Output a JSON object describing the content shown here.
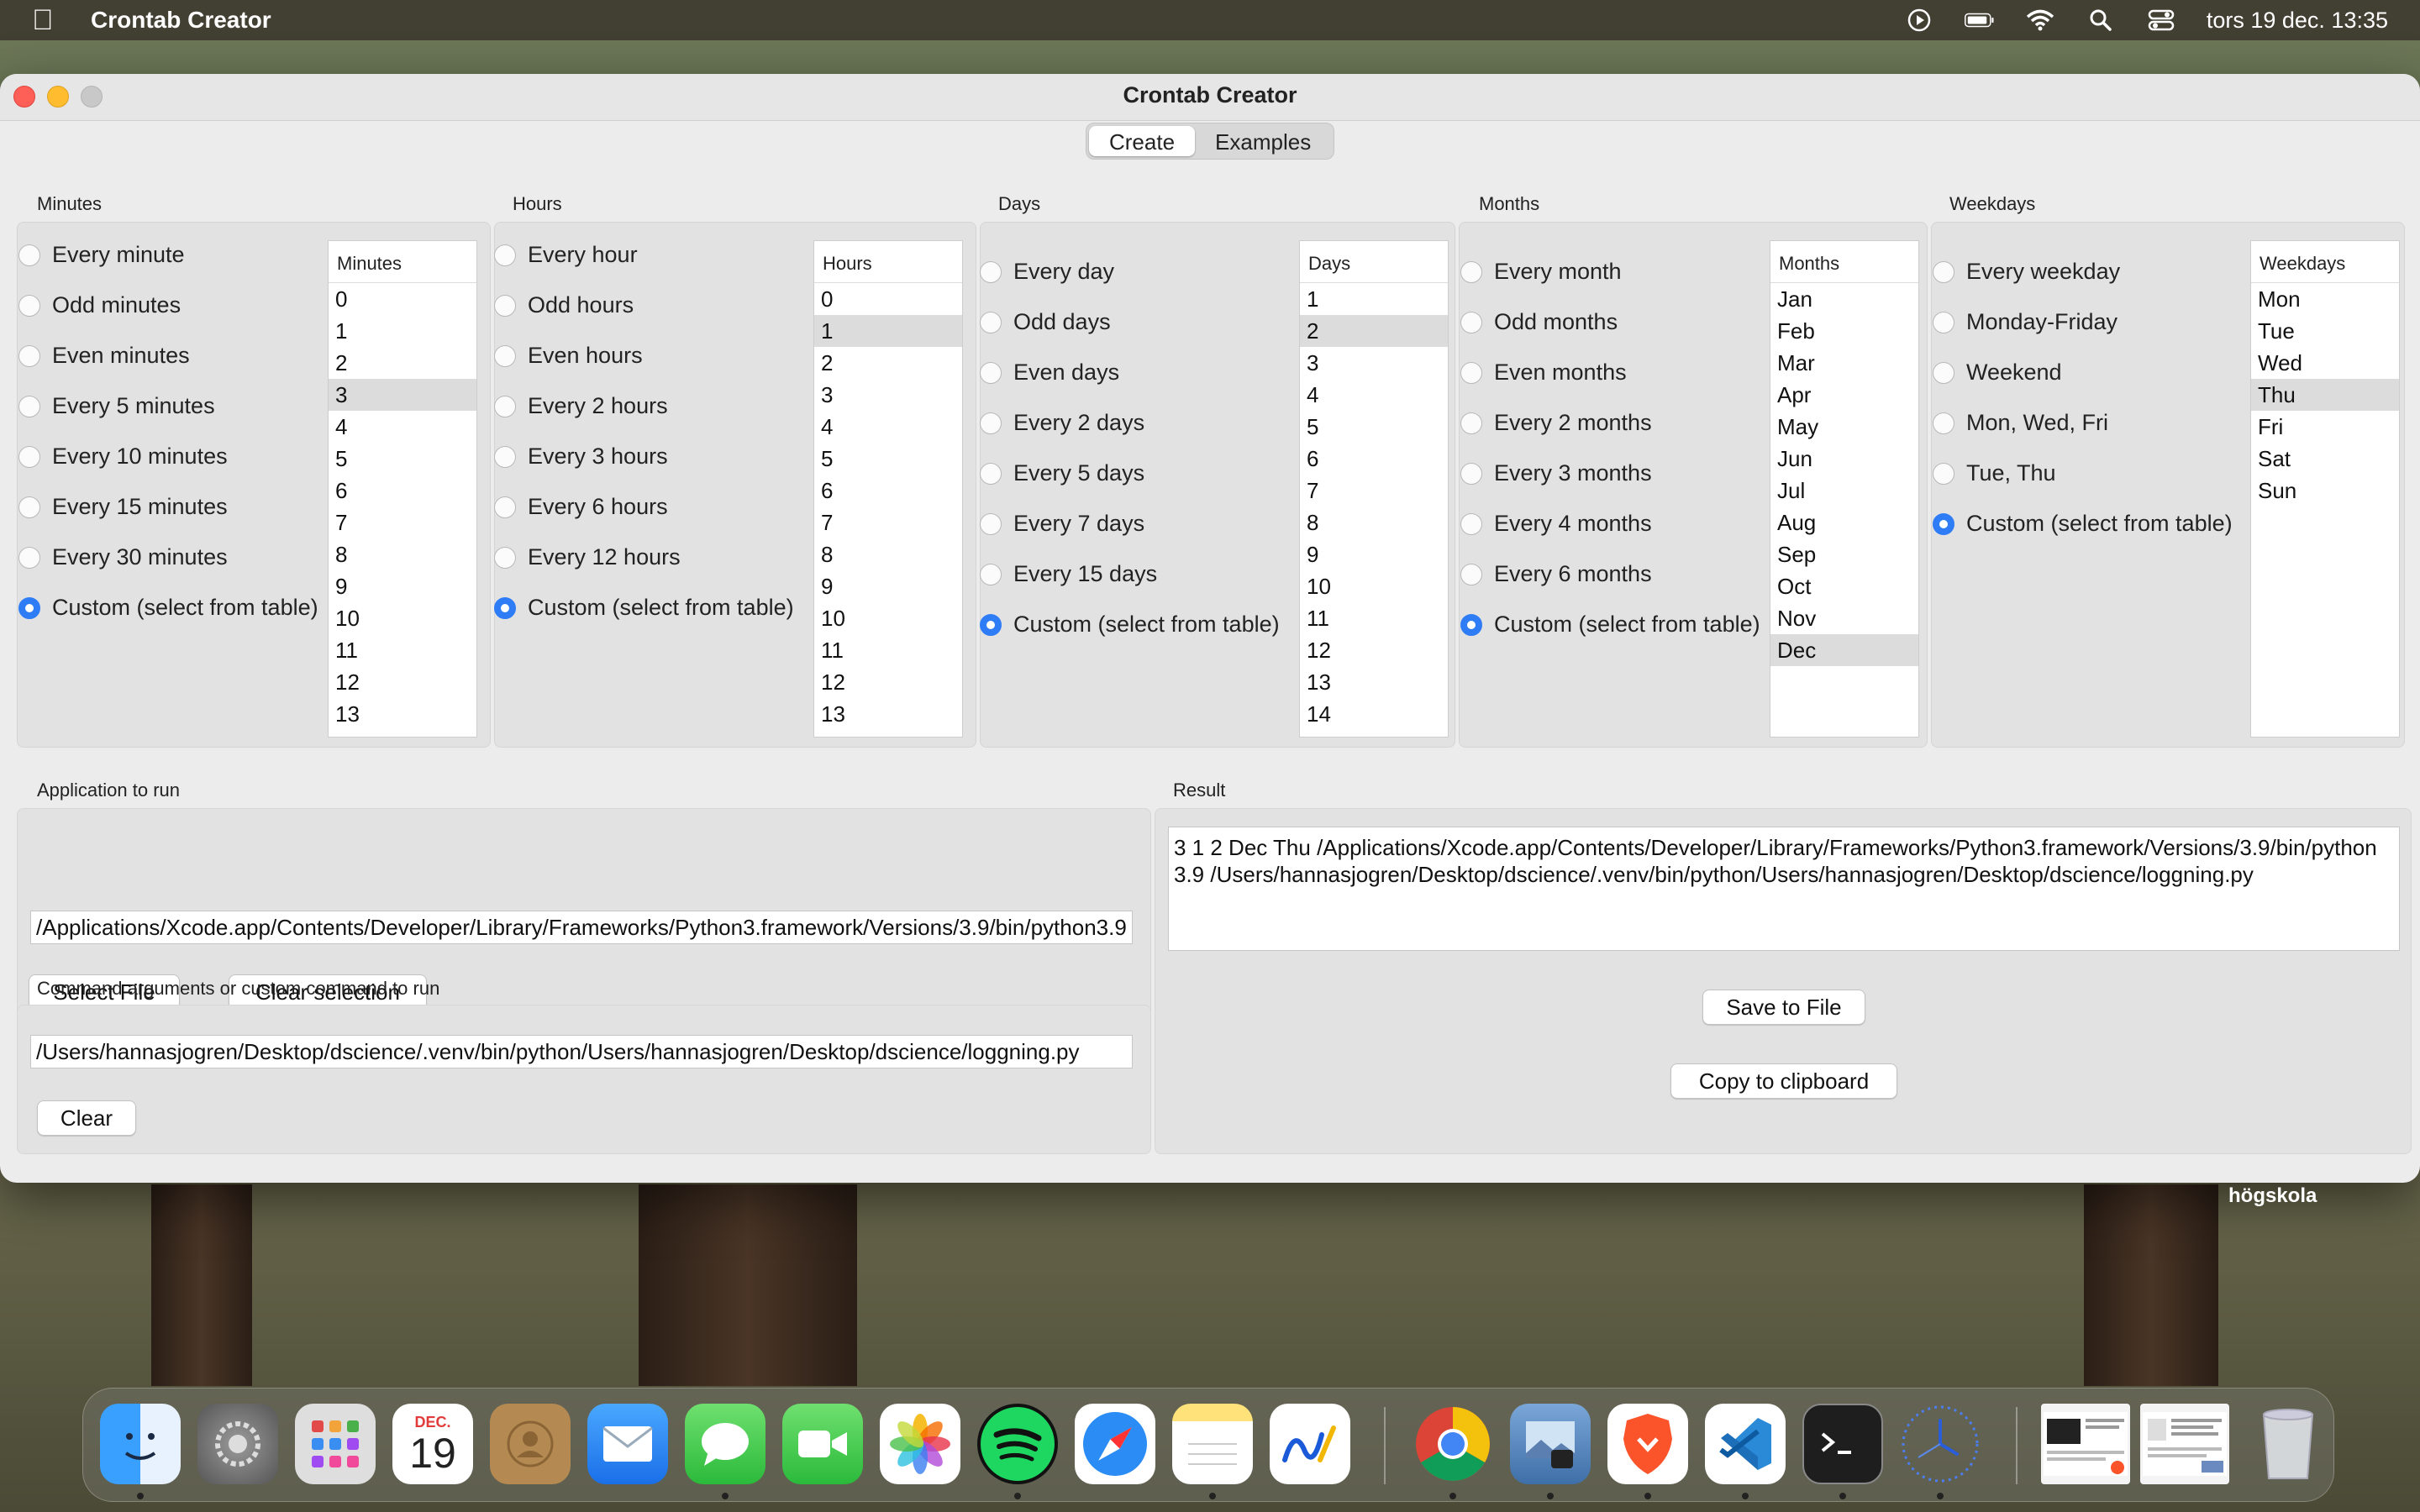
{
  "menubar": {
    "app_name": "Crontab Creator",
    "clock": "tors 19 dec. 13:35"
  },
  "window": {
    "title": "Crontab Creator",
    "tabs": [
      {
        "label": "Create",
        "active": true
      },
      {
        "label": "Examples",
        "active": false
      }
    ]
  },
  "groups": {
    "minutes": {
      "label": "Minutes",
      "options": [
        "Every minute",
        "Odd minutes",
        "Even minutes",
        "Every 5 minutes",
        "Every 10 minutes",
        "Every 15 minutes",
        "Every 30 minutes",
        "Custom (select from table)"
      ],
      "selected_option": 7,
      "table_header": "Minutes",
      "rows": [
        "0",
        "1",
        "2",
        "3",
        "4",
        "5",
        "6",
        "7",
        "8",
        "9",
        "10",
        "11",
        "12",
        "13"
      ],
      "selected_row": "3"
    },
    "hours": {
      "label": "Hours",
      "options": [
        "Every hour",
        "Odd hours",
        "Even hours",
        "Every 2 hours",
        "Every 3 hours",
        "Every 6 hours",
        "Every 12 hours",
        "Custom (select from table)"
      ],
      "selected_option": 7,
      "table_header": "Hours",
      "rows": [
        "0",
        "1",
        "2",
        "3",
        "4",
        "5",
        "6",
        "7",
        "8",
        "9",
        "10",
        "11",
        "12",
        "13"
      ],
      "selected_row": "1"
    },
    "days": {
      "label": "Days",
      "options": [
        "Every day",
        "Odd days",
        "Even days",
        "Every 2 days",
        "Every 5 days",
        "Every 7 days",
        "Every 15 days",
        "Custom (select from table)"
      ],
      "selected_option": 7,
      "table_header": "Days",
      "rows": [
        "1",
        "2",
        "3",
        "4",
        "5",
        "6",
        "7",
        "8",
        "9",
        "10",
        "11",
        "12",
        "13",
        "14"
      ],
      "selected_row": "2"
    },
    "months": {
      "label": "Months",
      "options": [
        "Every month",
        "Odd months",
        "Even months",
        "Every 2 months",
        "Every 3 months",
        "Every 4 months",
        "Every 6 months",
        "Custom (select from table)"
      ],
      "selected_option": 7,
      "table_header": "Months",
      "rows": [
        "Jan",
        "Feb",
        "Mar",
        "Apr",
        "May",
        "Jun",
        "Jul",
        "Aug",
        "Sep",
        "Oct",
        "Nov",
        "Dec"
      ],
      "selected_row": "Dec"
    },
    "weekdays": {
      "label": "Weekdays",
      "options": [
        "Every weekday",
        "Monday-Friday",
        "Weekend",
        "Mon, Wed, Fri",
        "Tue, Thu",
        "Custom (select from table)"
      ],
      "selected_option": 5,
      "table_header": "Weekdays",
      "rows": [
        "Mon",
        "Tue",
        "Wed",
        "Thu",
        "Fri",
        "Sat",
        "Sun"
      ],
      "selected_row": "Thu"
    }
  },
  "application": {
    "label": "Application to run",
    "value": "/Applications/Xcode.app/Contents/Developer/Library/Frameworks/Python3.framework/Versions/3.9/bin/python3.9",
    "select_button": "Select File",
    "clear_button": "Clear selection"
  },
  "arguments": {
    "label": "Command arguments or custom command to run",
    "value": "/Users/hannasjogren/Desktop/dscience/.venv/bin/python/Users/hannasjogren/Desktop/dscience/loggning.py",
    "clear_button": "Clear"
  },
  "result": {
    "label": "Result",
    "text": "3 1 2 Dec Thu /Applications/Xcode.app/Contents/Developer/Library/Frameworks/Python3.framework/Versions/3.9/bin/python3.9 /Users/hannasjogren/Desktop/dscience/.venv/bin/python/Users/hannasjogren/Desktop/dscience/loggning.py",
    "save_button": "Save to File",
    "copy_button": "Copy to clipboard"
  },
  "desktop": {
    "label": "högskola"
  },
  "dock": {
    "calendar_month": "DEC.",
    "calendar_day": "19",
    "icons": [
      "finder-icon",
      "system-settings-icon",
      "launchpad-icon",
      "calendar-icon",
      "contacts-icon",
      "mail-icon",
      "messages-icon",
      "facetime-icon",
      "photos-icon",
      "spotify-icon",
      "safari-icon",
      "notes-icon",
      "freeform-icon",
      "chrome-icon",
      "preview-icon",
      "brave-icon",
      "vscode-icon",
      "terminal-icon",
      "clock-icon",
      "window-thumbnail-1",
      "window-thumbnail-2",
      "trash-icon"
    ]
  },
  "colors": {
    "accent": "#2f7df6",
    "window_bg": "#ececec",
    "selected_row": "#dcdcdc"
  }
}
